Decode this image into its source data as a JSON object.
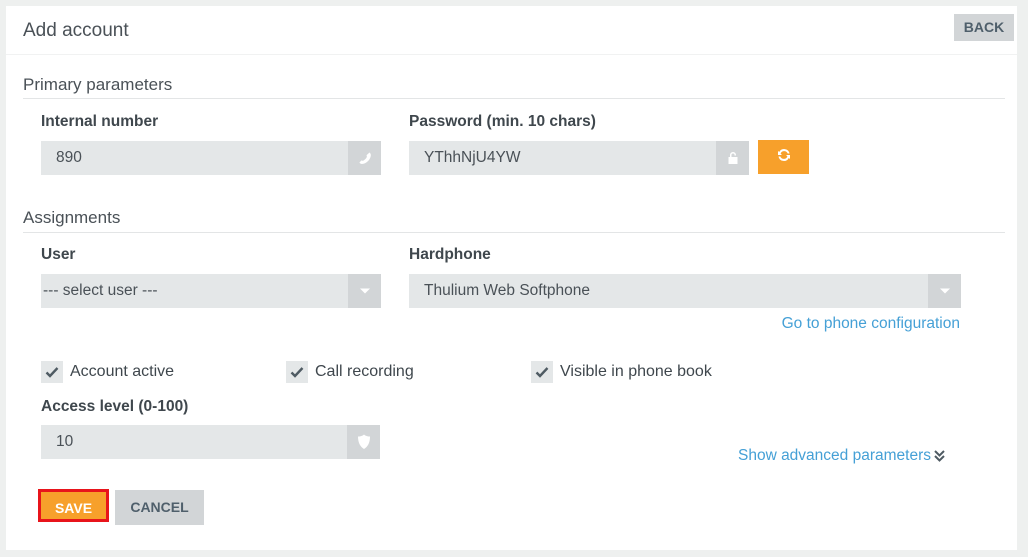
{
  "header": {
    "title": "Add account",
    "back_label": "BACK"
  },
  "primary": {
    "section_title": "Primary parameters",
    "internal_number": {
      "label": "Internal number",
      "value": "890",
      "icon": "phone-icon"
    },
    "password": {
      "label": "Password (min. 10 chars)",
      "value": "YThhNjU4YW",
      "icon": "unlock-icon",
      "regenerate_icon": "refresh-icon"
    }
  },
  "assignments": {
    "section_title": "Assignments",
    "user": {
      "label": "User",
      "selected": "--- select user ---"
    },
    "hardphone": {
      "label": "Hardphone",
      "selected": "Thulium Web Softphone",
      "config_link": "Go to phone configuration"
    },
    "checkboxes": [
      {
        "label": "Account active",
        "checked": true
      },
      {
        "label": "Call recording",
        "checked": true
      },
      {
        "label": "Visible in phone book",
        "checked": true
      }
    ],
    "access_level": {
      "label": "Access level (0-100)",
      "value": "10",
      "icon": "shield-icon"
    },
    "advanced_link": "Show advanced parameters"
  },
  "actions": {
    "save_label": "SAVE",
    "cancel_label": "CANCEL"
  },
  "colors": {
    "accent": "#f7a02b",
    "link": "#45a0d6",
    "focus_outline": "#e8141b"
  }
}
